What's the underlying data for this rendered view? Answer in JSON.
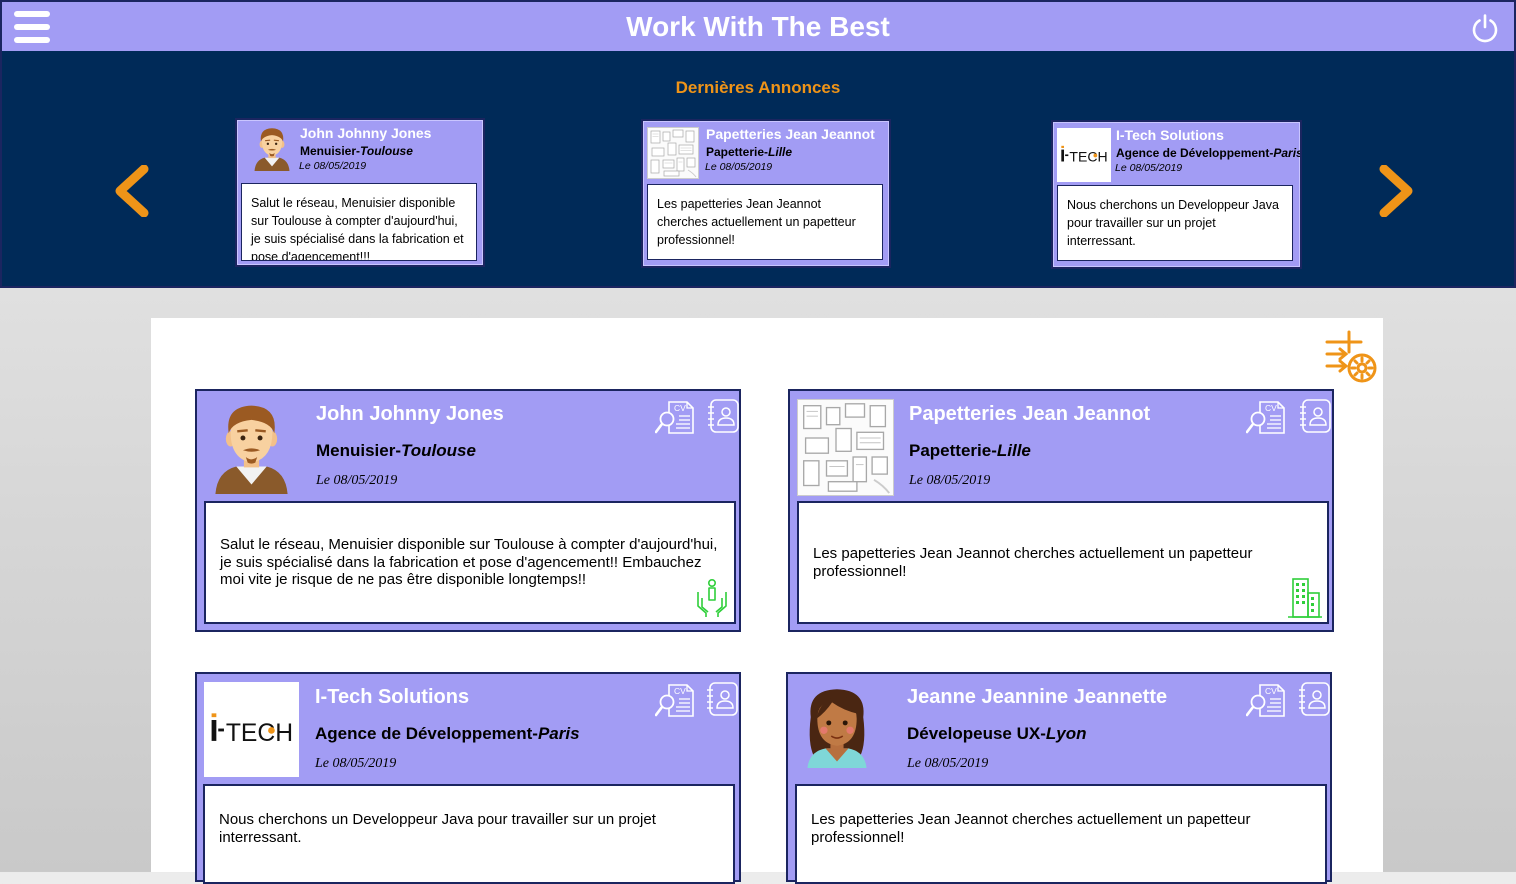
{
  "app": {
    "title": "Work With The Best"
  },
  "banner": {
    "title": "Dernières Annonces",
    "items": [
      {
        "name": "John Johnny Jones",
        "job": "Menuisier-",
        "city": "Toulouse",
        "date": "Le 08/05/2019",
        "message": "Salut le réseau, Menuisier disponible sur Toulouse à compter d'aujourd'hui, je suis spécialisé dans la fabrication et pose d'agencement!!!"
      },
      {
        "name": "Papetteries Jean Jeannot",
        "job": "Papetterie-",
        "city": "Lille",
        "date": "Le 08/05/2019",
        "message": "Les papetteries Jean Jeannot cherches actuellement un papetteur professionnel!"
      },
      {
        "name": "I-Tech Solutions",
        "job": "Agence de Développement-",
        "city": "Paris",
        "date": "Le 08/05/2019",
        "message": "Nous cherchons un Developpeur Java pour travailler sur un projet interressant."
      }
    ]
  },
  "logo_text": "i-TECH",
  "posts": [
    {
      "name": "John Johnny Jones",
      "job": "Menuisier-",
      "city": "Toulouse",
      "date": "Le 08/05/2019",
      "message": "Salut le réseau, Menuisier disponible sur Toulouse à compter d'aujourd'hui, je suis spécialisé dans la fabrication et pose d'agencement!! Embauchez moi vite je risque de ne pas être disponible longtemps!!",
      "badge_icon": "hands-person-icon",
      "badge_color": "#2fcf3a"
    },
    {
      "name": "Papetteries Jean Jeannot",
      "job": "Papetterie-",
      "city": "Lille",
      "date": "Le 08/05/2019",
      "message": "Les papetteries Jean Jeannot cherches actuellement un papetteur professionnel!",
      "badge_icon": "building-icon",
      "badge_color": "#2fcf3a"
    },
    {
      "name": "I-Tech Solutions",
      "job": "Agence de Développement-",
      "city": "Paris",
      "date": "Le 08/05/2019",
      "message": "Nous cherchons un Developpeur Java pour travailler sur un projet interressant."
    },
    {
      "name": "Jeanne Jeannine Jeannette",
      "job": "Dévelopeuse UX-",
      "city": "Lyon",
      "date": "Le 08/05/2019",
      "message": "Les papetteries Jean Jeannot cherches actuellement un papetteur professionnel!"
    }
  ],
  "colors": {
    "header": "#a29cf4",
    "banner": "#002a58",
    "accent": "#ef9418",
    "border": "#1b2560",
    "badge": "#2fcf3a"
  }
}
